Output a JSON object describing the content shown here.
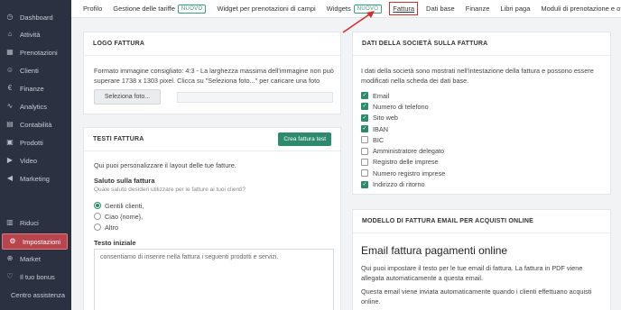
{
  "sidebar": {
    "items": [
      {
        "label": "Dashboard",
        "icon": "dashboard-icon",
        "glyph": "◷",
        "active": false
      },
      {
        "label": "Attività",
        "icon": "activity-icon",
        "glyph": "⌂",
        "active": false
      },
      {
        "label": "Prenotazioni",
        "icon": "calendar-icon",
        "glyph": "▦",
        "active": false
      },
      {
        "label": "Clienti",
        "icon": "user-icon",
        "glyph": "☺",
        "active": false
      },
      {
        "label": "Finanze",
        "icon": "euro-icon",
        "glyph": "€",
        "active": false
      },
      {
        "label": "Analytics",
        "icon": "chart-icon",
        "glyph": "∿",
        "active": false
      },
      {
        "label": "Contabilità",
        "icon": "document-icon",
        "glyph": "▤",
        "active": false
      },
      {
        "label": "Prodotti",
        "icon": "box-icon",
        "glyph": "▣",
        "active": false
      },
      {
        "label": "Video",
        "icon": "play-icon",
        "glyph": "▶",
        "active": false
      },
      {
        "label": "Marketing",
        "icon": "megaphone-icon",
        "glyph": "◀",
        "active": false
      },
      {
        "label": "Riduci",
        "icon": "collapse-icon",
        "glyph": "▥",
        "active": false
      },
      {
        "label": "Impostazioni",
        "icon": "gear-icon",
        "glyph": "⚙",
        "active": true
      },
      {
        "label": "Market",
        "icon": "cart-icon",
        "glyph": "⊕",
        "active": false
      },
      {
        "label": "Il tuo bonus",
        "icon": "heart-icon",
        "glyph": "♡",
        "active": false
      }
    ],
    "help": "Centro assistenza"
  },
  "topnav": {
    "tabs": [
      {
        "label": "Profilo",
        "badge": ""
      },
      {
        "label": "Gestione delle tariffe",
        "badge": "NUOVO"
      },
      {
        "label": "Widget per prenotazioni di campi",
        "badge": ""
      },
      {
        "label": "Widgets",
        "badge": "NUOVO"
      },
      {
        "label": "Fattura",
        "badge": "",
        "active": true
      },
      {
        "label": "Dati base",
        "badge": ""
      },
      {
        "label": "Finanze",
        "badge": ""
      },
      {
        "label": "Libri paga",
        "badge": ""
      },
      {
        "label": "Moduli di prenotazione e offerte",
        "badge": ""
      }
    ]
  },
  "logo_card": {
    "title": "LOGO FATTURA",
    "description": "Formato immagine consigliato: 4:3 - La larghezza massima dell'immagine non può superare 1738 x 1303 pixel. Clicca su \"Seleziona foto...\" per caricare una foto",
    "button": "Seleziona foto..."
  },
  "texts_card": {
    "title": "TESTI FATTURA",
    "button": "Crea fattura test",
    "intro": "Qui puoi personalizzare il layout delle tue fatture.",
    "greeting_label": "Saluto sulla fattura",
    "greeting_hint": "Quale saluto desideri utilizzare per le fatture ai tuoi clienti?",
    "options": [
      {
        "label": "Gentili clienti,",
        "selected": true
      },
      {
        "label": "Ciao {nome},",
        "selected": false
      },
      {
        "label": "Altro",
        "selected": false
      }
    ],
    "initial_label": "Testo iniziale",
    "initial_value": "consentiamo di inserire nella fattura i seguenti prodotti e servizi."
  },
  "company_card": {
    "title": "DATI DELLA SOCIETÀ SULLA FATTURA",
    "description": "I dati della società sono mostrati nell'intestazione della fattura e possono essere modificati nella scheda dei dati base.",
    "fields": [
      {
        "label": "Email",
        "checked": true
      },
      {
        "label": "Numero di telefono",
        "checked": true
      },
      {
        "label": "Sito web",
        "checked": true
      },
      {
        "label": "IBAN",
        "checked": true
      },
      {
        "label": "BIC",
        "checked": false
      },
      {
        "label": "Amministratore delegato",
        "checked": false
      },
      {
        "label": "Registro delle imprese",
        "checked": false
      },
      {
        "label": "Numero registro imprese",
        "checked": false
      },
      {
        "label": "Indirizzo di ritorno",
        "checked": true
      }
    ]
  },
  "email_card": {
    "title": "MODELLO DI FATTURA EMAIL PER ACQUISTI ONLINE",
    "heading": "Email fattura pagamenti online",
    "para1": "Qui puoi impostare il testo per le tue email di fattura. La fattura in PDF viene allegata automaticamente a questa email.",
    "para2": "Questa email viene inviata automaticamente quando i clienti effettuano acquisti online."
  },
  "colors": {
    "sidebar_bg": "#2c3142",
    "active_bg": "#b8444d",
    "accent_green": "#2e8a6c",
    "highlight_red": "#d62e2e"
  }
}
